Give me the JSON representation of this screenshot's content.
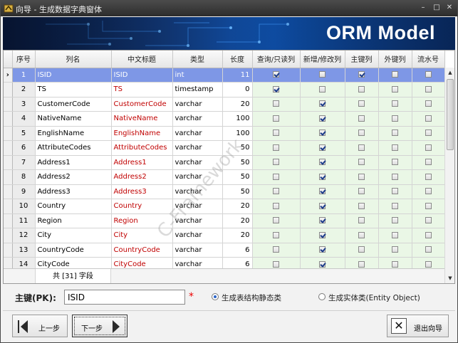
{
  "window": {
    "title": "向导 - 生成数据字典窗体",
    "controls": [
      "–",
      "□",
      "✕"
    ]
  },
  "banner": {
    "title": "ORM Model"
  },
  "grid": {
    "columns": [
      "序号",
      "列名",
      "中文标题",
      "类型",
      "长度",
      "查询/只读列",
      "新增/修改列",
      "主键列",
      "外键列",
      "流水号"
    ],
    "rows": [
      {
        "no": "1",
        "name": "ISID",
        "title": "ISID",
        "type": "int",
        "len": "11",
        "query": true,
        "edit": false,
        "pk": true,
        "fk": false,
        "serial": false
      },
      {
        "no": "2",
        "name": "TS",
        "title": "TS",
        "type": "timestamp",
        "len": "0",
        "query": true,
        "edit": false,
        "pk": false,
        "fk": false,
        "serial": false
      },
      {
        "no": "3",
        "name": "CustomerCode",
        "title": "CustomerCode",
        "type": "varchar",
        "len": "20",
        "query": false,
        "edit": true,
        "pk": false,
        "fk": false,
        "serial": false
      },
      {
        "no": "4",
        "name": "NativeName",
        "title": "NativeName",
        "type": "varchar",
        "len": "100",
        "query": false,
        "edit": true,
        "pk": false,
        "fk": false,
        "serial": false
      },
      {
        "no": "5",
        "name": "EnglishName",
        "title": "EnglishName",
        "type": "varchar",
        "len": "100",
        "query": false,
        "edit": true,
        "pk": false,
        "fk": false,
        "serial": false
      },
      {
        "no": "6",
        "name": "AttributeCodes",
        "title": "AttributeCodes",
        "type": "varchar",
        "len": "50",
        "query": false,
        "edit": true,
        "pk": false,
        "fk": false,
        "serial": false
      },
      {
        "no": "7",
        "name": "Address1",
        "title": "Address1",
        "type": "varchar",
        "len": "50",
        "query": false,
        "edit": true,
        "pk": false,
        "fk": false,
        "serial": false
      },
      {
        "no": "8",
        "name": "Address2",
        "title": "Address2",
        "type": "varchar",
        "len": "50",
        "query": false,
        "edit": true,
        "pk": false,
        "fk": false,
        "serial": false
      },
      {
        "no": "9",
        "name": "Address3",
        "title": "Address3",
        "type": "varchar",
        "len": "50",
        "query": false,
        "edit": true,
        "pk": false,
        "fk": false,
        "serial": false
      },
      {
        "no": "10",
        "name": "Country",
        "title": "Country",
        "type": "varchar",
        "len": "20",
        "query": false,
        "edit": true,
        "pk": false,
        "fk": false,
        "serial": false
      },
      {
        "no": "11",
        "name": "Region",
        "title": "Region",
        "type": "varchar",
        "len": "20",
        "query": false,
        "edit": true,
        "pk": false,
        "fk": false,
        "serial": false
      },
      {
        "no": "12",
        "name": "City",
        "title": "City",
        "type": "varchar",
        "len": "20",
        "query": false,
        "edit": true,
        "pk": false,
        "fk": false,
        "serial": false
      },
      {
        "no": "13",
        "name": "CountryCode",
        "title": "CountryCode",
        "type": "varchar",
        "len": "6",
        "query": false,
        "edit": true,
        "pk": false,
        "fk": false,
        "serial": false
      },
      {
        "no": "14",
        "name": "CityCode",
        "title": "CityCode",
        "type": "varchar",
        "len": "6",
        "query": false,
        "edit": true,
        "pk": false,
        "fk": false,
        "serial": false
      }
    ],
    "footer_count": "共 [31] 字段",
    "watermark": "C-Framework"
  },
  "pk": {
    "label": "主键(PK):",
    "value": "ISID",
    "required_mark": "*",
    "option_static": "生成表结构静态类",
    "option_entity": "生成实体类(Entity Object)",
    "selected": "static"
  },
  "buttons": {
    "prev": "上一步",
    "next": "下一步",
    "exit": "退出向导"
  },
  "colors": {
    "selected_row": "#7e97e6",
    "red_text": "#c00000",
    "check_bg": "#eaf7e6"
  }
}
